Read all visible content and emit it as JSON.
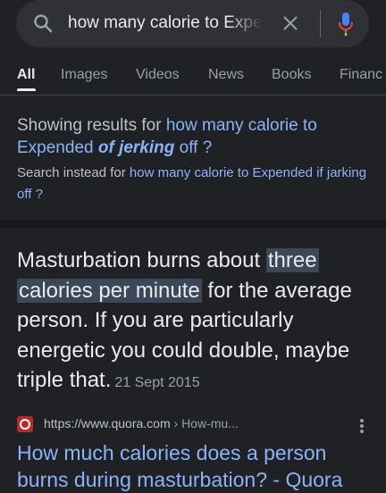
{
  "search": {
    "query": "how many calorie to Expe",
    "icon": "search-icon",
    "clear_icon": "close-icon",
    "mic_icon": "mic-icon"
  },
  "tabs": [
    {
      "label": "All",
      "active": true
    },
    {
      "label": "Images"
    },
    {
      "label": "Videos"
    },
    {
      "label": "News"
    },
    {
      "label": "Books"
    },
    {
      "label": "Financ"
    }
  ],
  "spelling": {
    "showing_prefix": "Showing results for ",
    "corrected_part1": "how many calorie to",
    "corrected_part2": "Expended ",
    "corrected_emph": "of jerking",
    "corrected_part3": " off ?",
    "instead_prefix": "Search instead for ",
    "original_query": "how many calorie to Expended if jarking off ?"
  },
  "snippet": {
    "text1": "Masturbation burns about ",
    "highlight1": "three",
    "highlight2": "calories per minute",
    "text2": " for the average person. If you are particularly energetic you could double, maybe triple that.",
    "date": "21 Sept 2015"
  },
  "result": {
    "url": "https://www.quora.com",
    "breadcrumb": " › How-mu...",
    "title": "How much calories does a person burns during masturbation? - Quora",
    "favicon": "quora-logo"
  },
  "colors": {
    "background": "#202124",
    "link": "#8ab4f8",
    "highlight": "#3c4758",
    "quora": "#b92b27"
  }
}
